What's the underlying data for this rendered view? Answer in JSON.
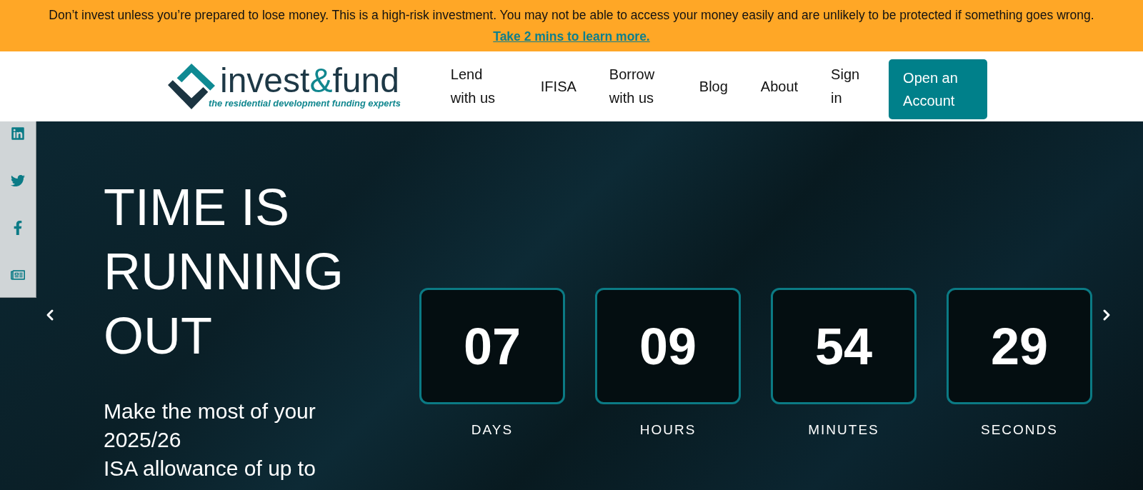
{
  "risk_banner": {
    "text": "Don’t invest unless you’re prepared to lose money. This is a high-risk investment. You may not be able to access your money easily and are unlikely to be protected if something goes wrong.",
    "link": "Take 2 mins to learn more."
  },
  "header": {
    "logo": {
      "wordmark": [
        {
          "text": "invest",
          "accent": false
        },
        {
          "text": "&",
          "accent": true
        },
        {
          "text": "fund",
          "accent": false
        }
      ],
      "tagline": "the residential development funding experts"
    },
    "nav": [
      {
        "label": "Lend with us"
      },
      {
        "label": "IFISA"
      },
      {
        "label": "Borrow with us"
      },
      {
        "label": "Blog"
      },
      {
        "label": "About"
      },
      {
        "label": "Sign in"
      }
    ],
    "cta": "Open an Account"
  },
  "hero": {
    "title": "TIME IS RUNNING OUT",
    "subtitle_lines": [
      "Make the most of your 2025/26",
      "ISA allowance of up to"
    ],
    "countdown": [
      {
        "value": "07",
        "label": "DAYS"
      },
      {
        "value": "09",
        "label": "HOURS"
      },
      {
        "value": "54",
        "label": "MINUTES"
      },
      {
        "value": "29",
        "label": "SECONDS"
      }
    ]
  }
}
